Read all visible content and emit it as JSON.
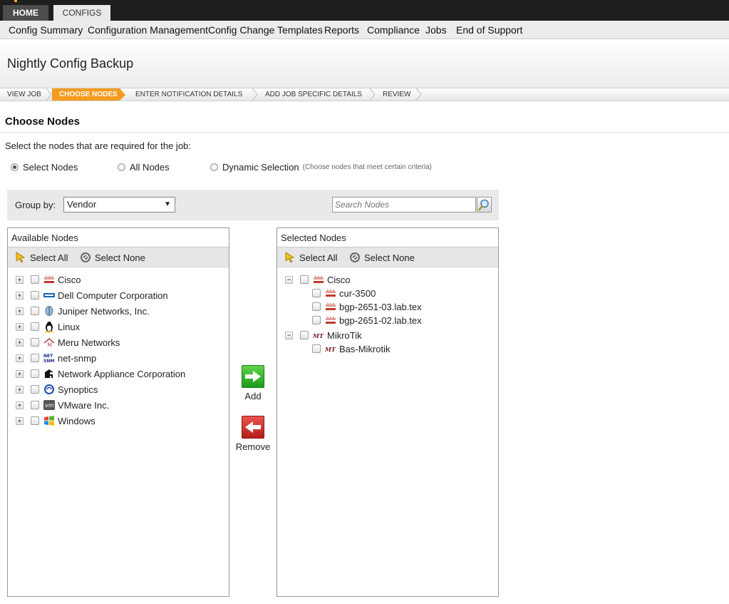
{
  "top_tabs": {
    "home": "HOME",
    "configs": "CONFIGS"
  },
  "subnav": [
    "Config Summary",
    "Configuration Management",
    "Config Change Templates",
    "Reports",
    "Compliance",
    "Jobs",
    "End of Support"
  ],
  "page_title": "Nightly Config Backup",
  "wizard_steps": [
    "VIEW JOB",
    "CHOOSE NODES",
    "ENTER NOTIFICATION DETAILS",
    "ADD JOB SPECIFIC DETAILS",
    "REVIEW"
  ],
  "active_step": "CHOOSE NODES",
  "section_title": "Choose Nodes",
  "instructions": "Select the nodes that are required for the job:",
  "selection_modes": {
    "select_nodes": "Select Nodes",
    "all_nodes": "All Nodes",
    "dynamic_selection": "Dynamic Selection",
    "dynamic_hint": "(Choose nodes that meet certain criteria)",
    "selected": "Select Nodes"
  },
  "group_by": {
    "label": "Group by:",
    "value": "Vendor"
  },
  "search": {
    "placeholder": "Search Nodes"
  },
  "available_panel": {
    "title": "Available Nodes",
    "select_all": "Select All",
    "select_none": "Select None",
    "vendors": [
      {
        "name": "Cisco",
        "icon": "cisco-icon"
      },
      {
        "name": "Dell Computer Corporation",
        "icon": "dell-icon"
      },
      {
        "name": "Juniper Networks, Inc.",
        "icon": "juniper-icon"
      },
      {
        "name": "Linux",
        "icon": "linux-icon"
      },
      {
        "name": "Meru Networks",
        "icon": "meru-icon"
      },
      {
        "name": "net-snmp",
        "icon": "net-snmp-icon"
      },
      {
        "name": "Network Appliance Corporation",
        "icon": "netapp-icon"
      },
      {
        "name": "Synoptics",
        "icon": "synoptics-icon"
      },
      {
        "name": "VMware Inc.",
        "icon": "vmware-icon"
      },
      {
        "name": "Windows",
        "icon": "windows-icon"
      }
    ]
  },
  "actions": {
    "add": "Add",
    "remove": "Remove"
  },
  "selected_panel": {
    "title": "Selected Nodes",
    "select_all": "Select All",
    "select_none": "Select None",
    "groups": [
      {
        "name": "Cisco",
        "icon": "cisco-icon",
        "nodes": [
          "cur-3500",
          "bgp-2651-03.lab.tex",
          "bgp-2651-02.lab.tex"
        ]
      },
      {
        "name": "MikroTik",
        "icon": "mikrotik-icon",
        "nodes": [
          "Bas-Mikrotik"
        ]
      }
    ]
  },
  "colors": {
    "accent": "#f59b1f",
    "topbar": "#1e1e1e",
    "add": "#1e9a1c",
    "remove": "#b41d1a"
  }
}
